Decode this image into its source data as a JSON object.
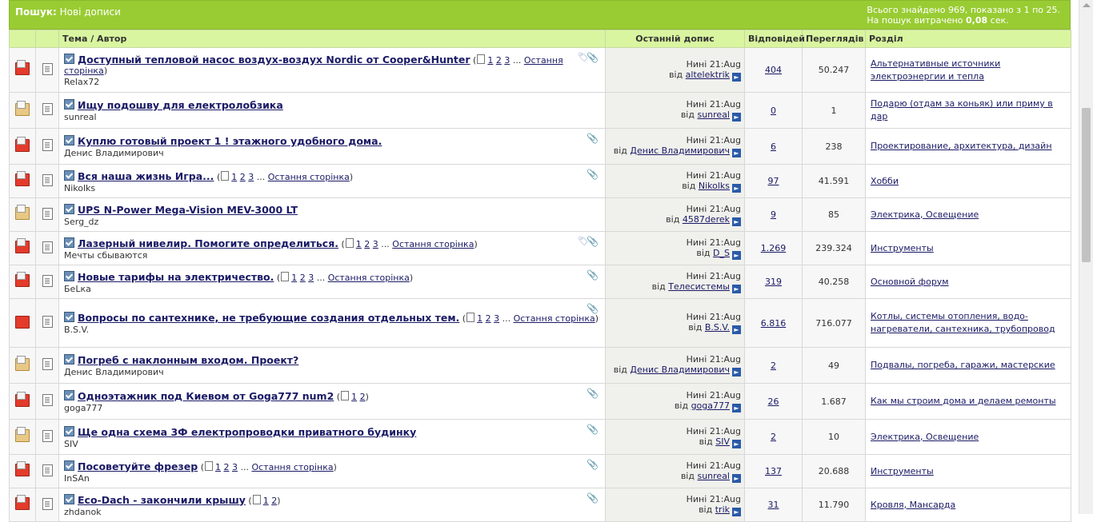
{
  "header": {
    "search_label": "Пошук:",
    "search_value": "Нові дописи",
    "stats_line1": "Всього знайдено 969, показано з 1 по 25.",
    "stats_line2_prefix": "На пошук витрачено ",
    "stats_time": "0,08",
    "stats_line2_suffix": " сек."
  },
  "columns": {
    "topic": "Тема / Автор",
    "last": "Останній допис",
    "replies": "Відповідей",
    "views": "Переглядів",
    "section": "Розділ"
  },
  "common": {
    "last_page": "Остання сторінка",
    "today": "Нині",
    "by": "від"
  },
  "rows": [
    {
      "title": "Доступный тепловой насос воздух-воздух Nordic от Cooper&Hunter",
      "pages": [
        "1",
        "2",
        "3"
      ],
      "ellipsis": true,
      "author": "Relax72",
      "time": "21:Aug",
      "last_by": "altelektrik",
      "replies": "404",
      "views": "50.247",
      "section": "Альтернативные источники электроэнергии и тепла",
      "icon": "hot",
      "clip": true,
      "tag": true
    },
    {
      "title": "Ищу подошву для електролобзика",
      "pages": [],
      "ellipsis": false,
      "author": "sunreal",
      "time": "21:Aug",
      "last_by": "sunreal",
      "replies": "0",
      "views": "1",
      "section": "Подарю (отдам за коньяк) или приму в дар",
      "icon": "cold",
      "clip": false,
      "tag": false
    },
    {
      "title": "Куплю готовый проект 1 ! этажного удобного дома.",
      "pages": [],
      "ellipsis": false,
      "author": "Денис Владимирович",
      "time": "21:Aug",
      "last_by": "Денис Владимирович",
      "replies": "6",
      "views": "238",
      "section": "Проектирование, архитектура, дизайн",
      "icon": "hot",
      "clip": true,
      "tag": false
    },
    {
      "title": "Вся наша жизнь Игра...",
      "pages": [
        "1",
        "2",
        "3"
      ],
      "ellipsis": true,
      "author": "Nikolks",
      "time": "21:Aug",
      "last_by": "Nikolks",
      "replies": "97",
      "views": "41.591",
      "section": "Хобби",
      "icon": "hot",
      "clip": true,
      "tag": false
    },
    {
      "title": "UPS N-Power Mega-Vision MEV-3000 LT",
      "pages": [],
      "ellipsis": false,
      "author": "Serg_dz",
      "time": "21:Aug",
      "last_by": "4587derek",
      "replies": "9",
      "views": "85",
      "section": "Электрика, Освещение",
      "icon": "cold",
      "clip": false,
      "tag": false
    },
    {
      "title": "Лазерный нивелир. Помогите определиться.",
      "pages": [
        "1",
        "2",
        "3"
      ],
      "ellipsis": true,
      "author": "Мечты сбываются",
      "time": "21:Aug",
      "last_by": "D_S",
      "replies": "1.269",
      "views": "239.324",
      "section": "Инструменты",
      "icon": "hot",
      "clip": true,
      "tag": true
    },
    {
      "title": "Новые тарифы на электричество.",
      "pages": [
        "1",
        "2",
        "3"
      ],
      "ellipsis": true,
      "author": "БеLка",
      "time": "21:Aug",
      "last_by": "Телесистемы",
      "replies": "319",
      "views": "40.258",
      "section": "Основной форум",
      "icon": "hot",
      "clip": true,
      "tag": false
    },
    {
      "title": "Вопросы по сантехнике, не требующие создания отдельных тем.",
      "pages": [
        "1",
        "2",
        "3"
      ],
      "ellipsis": true,
      "author": "B.S.V.",
      "time": "21:Aug",
      "last_by": "B.S.V.",
      "replies": "6.816",
      "views": "716.077",
      "section": "Котлы, системы отопления, водо-нагреватели, сантехника, трубопровод",
      "icon": "locked",
      "clip": true,
      "tag": false
    },
    {
      "title": "Погреб с наклонным входом. Проект?",
      "pages": [],
      "ellipsis": false,
      "author": "Денис Владимирович",
      "time": "21:Aug",
      "last_by": "Денис Владимирович",
      "replies": "2",
      "views": "49",
      "section": "Подвалы, погреба, гаражи, мастерские",
      "icon": "cold",
      "clip": false,
      "tag": false
    },
    {
      "title": "Одноэтажник под Киевом от Goga777 num2",
      "pages": [
        "1",
        "2"
      ],
      "ellipsis": false,
      "author": "goga777",
      "time": "21:Aug",
      "last_by": "goga777",
      "replies": "26",
      "views": "1.687",
      "section": "Как мы строим дома и делаем ремонты",
      "icon": "hot",
      "clip": true,
      "tag": false
    },
    {
      "title": "Ще одна схема 3Ф електропроводки приватного будинку",
      "pages": [],
      "ellipsis": false,
      "author": "SIV",
      "time": "21:Aug",
      "last_by": "SIV",
      "replies": "2",
      "views": "10",
      "section": "Электрика, Освещение",
      "icon": "cold",
      "clip": true,
      "tag": false
    },
    {
      "title": "Посоветуйте фрезер",
      "pages": [
        "1",
        "2",
        "3"
      ],
      "ellipsis": true,
      "author": "InSAn",
      "time": "21:Aug",
      "last_by": "sunreal",
      "replies": "137",
      "views": "20.688",
      "section": "Инструменты",
      "icon": "hot",
      "clip": true,
      "tag": false
    },
    {
      "title": "Eco-Dach - закончили крышу",
      "pages": [
        "1",
        "2"
      ],
      "ellipsis": false,
      "author": "zhdanok",
      "time": "21:Aug",
      "last_by": "trik",
      "replies": "31",
      "views": "11.790",
      "section": "Кровля, Мансарда",
      "icon": "hot",
      "clip": true,
      "tag": false
    }
  ]
}
